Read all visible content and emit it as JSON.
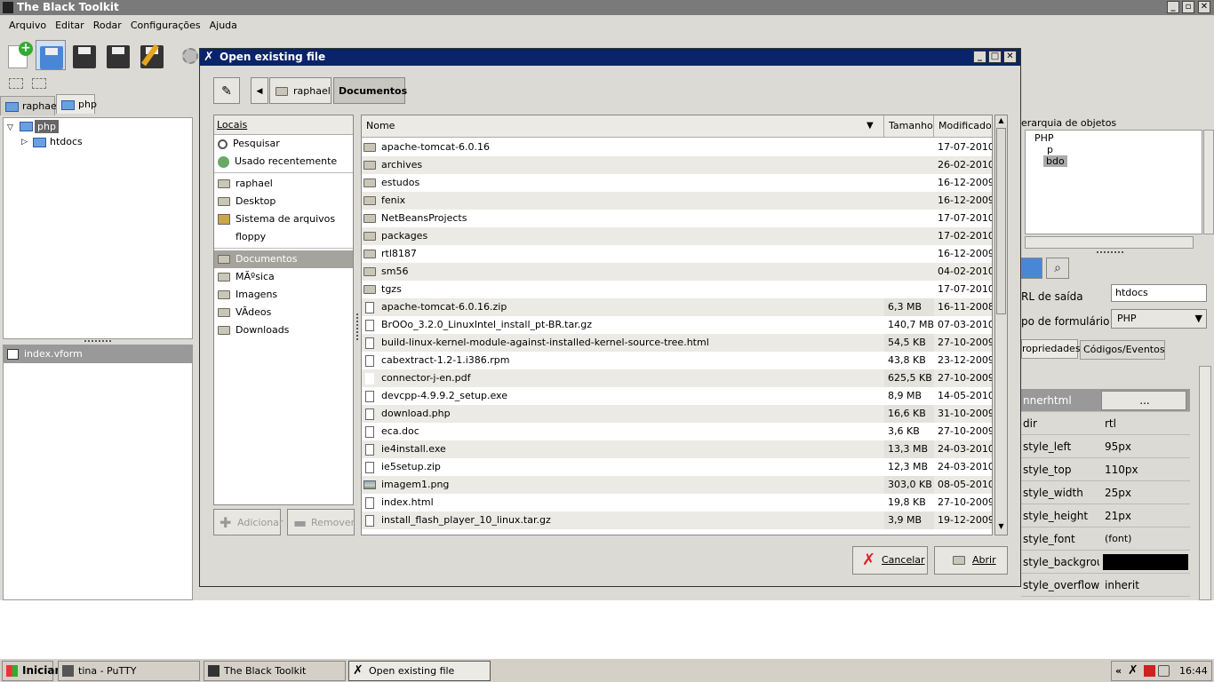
{
  "app": {
    "title": "The Black Toolkit",
    "menu": [
      "Arquivo",
      "Editar",
      "Rodar",
      "Configurações",
      "Ajuda"
    ]
  },
  "left_panel": {
    "tabs": [
      "raphael",
      "php"
    ],
    "tree": [
      {
        "label": "php",
        "selected": true
      },
      {
        "label": "htdocs"
      }
    ],
    "files": [
      "index.vform"
    ]
  },
  "dialog": {
    "title": "Open existing file",
    "path": [
      "raphael",
      "Documentos"
    ],
    "places_header": "Locais",
    "places": [
      {
        "label": "Pesquisar",
        "icon": "search-icon"
      },
      {
        "label": "Usado recentemente",
        "icon": "recent-icon"
      },
      {
        "label": "raphael",
        "icon": "folder-icon"
      },
      {
        "label": "Desktop",
        "icon": "folder-icon"
      },
      {
        "label": "Sistema de arquivos",
        "icon": "drive-icon"
      },
      {
        "label": "floppy",
        "icon": "none"
      },
      {
        "label": "Documentos",
        "icon": "folder-icon",
        "selected": true
      },
      {
        "label": "MÃºsica",
        "icon": "folder-icon"
      },
      {
        "label": "Imagens",
        "icon": "folder-icon"
      },
      {
        "label": "VÃdeos",
        "icon": "folder-icon"
      },
      {
        "label": "Downloads",
        "icon": "folder-icon"
      }
    ],
    "add_label": "Adicionar",
    "remove_label": "Remover",
    "columns": {
      "name": "Nome",
      "size": "Tamanho",
      "modified": "Modificado"
    },
    "files": [
      {
        "name": "apache-tomcat-6.0.16",
        "size": "",
        "date": "17-07-2010",
        "type": "folder"
      },
      {
        "name": "archives",
        "size": "",
        "date": "26-02-2010",
        "type": "folder"
      },
      {
        "name": "estudos",
        "size": "",
        "date": "16-12-2009",
        "type": "folder"
      },
      {
        "name": "fenix",
        "size": "",
        "date": "16-12-2009",
        "type": "folder"
      },
      {
        "name": "NetBeansProjects",
        "size": "",
        "date": "17-07-2010",
        "type": "folder"
      },
      {
        "name": "packages",
        "size": "",
        "date": "17-02-2010",
        "type": "folder"
      },
      {
        "name": "rtl8187",
        "size": "",
        "date": "16-12-2009",
        "type": "folder"
      },
      {
        "name": "sm56",
        "size": "",
        "date": "04-02-2010",
        "type": "folder"
      },
      {
        "name": "tgzs",
        "size": "",
        "date": "17-07-2010",
        "type": "folder"
      },
      {
        "name": "apache-tomcat-6.0.16.zip",
        "size": "6,3 MB",
        "date": "16-11-2008",
        "type": "file"
      },
      {
        "name": "BrOOo_3.2.0_LinuxIntel_install_pt-BR.tar.gz",
        "size": "140,7 MB",
        "date": "07-03-2010",
        "type": "file"
      },
      {
        "name": "build-linux-kernel-module-against-installed-kernel-source-tree.html",
        "size": "54,5 KB",
        "date": "27-10-2009",
        "type": "file"
      },
      {
        "name": "cabextract-1.2-1.i386.rpm",
        "size": "43,8 KB",
        "date": "23-12-2009",
        "type": "file"
      },
      {
        "name": "connector-j-en.pdf",
        "size": "625,5 KB",
        "date": "27-10-2009",
        "type": "blank"
      },
      {
        "name": "devcpp-4.9.9.2_setup.exe",
        "size": "8,9 MB",
        "date": "14-05-2010",
        "type": "file"
      },
      {
        "name": "download.php",
        "size": "16,6 KB",
        "date": "31-10-2009",
        "type": "file"
      },
      {
        "name": "eca.doc",
        "size": "3,6 KB",
        "date": "27-10-2009",
        "type": "file"
      },
      {
        "name": "ie4install.exe",
        "size": "13,3 MB",
        "date": "24-03-2010",
        "type": "file"
      },
      {
        "name": "ie5setup.zip",
        "size": "12,3 MB",
        "date": "24-03-2010",
        "type": "file"
      },
      {
        "name": "imagem1.png",
        "size": "303,0 KB",
        "date": "08-05-2010",
        "type": "image"
      },
      {
        "name": "index.html",
        "size": "19,8 KB",
        "date": "27-10-2009",
        "type": "file"
      },
      {
        "name": "install_flash_player_10_linux.tar.gz",
        "size": "3,9 MB",
        "date": "19-12-2009",
        "type": "file"
      }
    ],
    "cancel_label": "Cancelar",
    "open_label": "Abrir"
  },
  "right_panel": {
    "hierarchy_label": "erarquia de objetos",
    "tree": [
      "PHP",
      "p",
      "bdo"
    ],
    "url_label": "RL de saída",
    "url_value": "htdocs",
    "form_type_label": "po de formulário",
    "form_type_value": "PHP",
    "tabs": [
      "ropriedades",
      "Códigos/Eventos"
    ],
    "properties": [
      {
        "k": "nnerhtml",
        "v": "..."
      },
      {
        "k": "dir",
        "v": "rtl"
      },
      {
        "k": "style_left",
        "v": "95px"
      },
      {
        "k": "style_top",
        "v": "110px"
      },
      {
        "k": "style_width",
        "v": "25px"
      },
      {
        "k": "style_height",
        "v": "21px"
      },
      {
        "k": "style_font",
        "v": "(font)"
      },
      {
        "k": "style_backgrour",
        "v": ""
      },
      {
        "k": "style_overflow",
        "v": "inherit"
      }
    ],
    "bg_color": "#000000"
  },
  "taskbar": {
    "start": "Iniciar",
    "tasks": [
      "tina - PuTTY",
      "The Black Toolkit",
      "Open existing file"
    ],
    "tray_arrows": "«",
    "clock": "16:44"
  }
}
